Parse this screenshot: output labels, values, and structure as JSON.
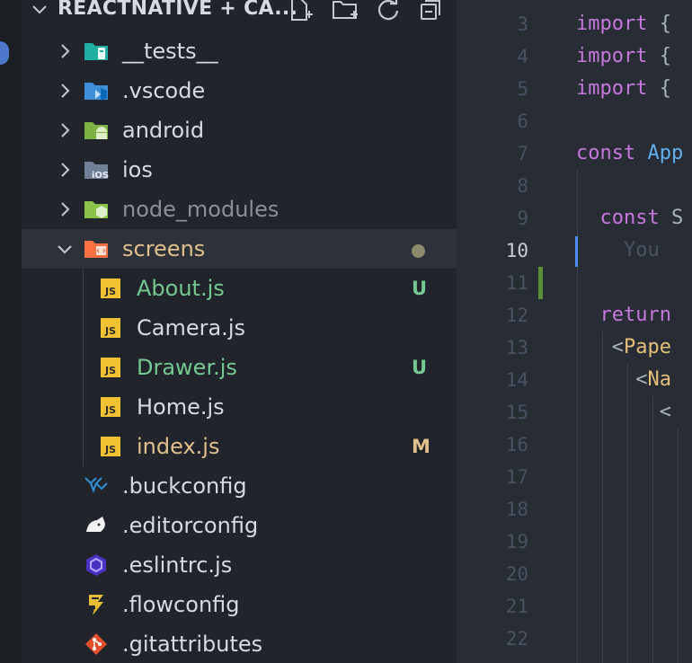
{
  "explorer": {
    "title": "REACTNATIVE + CA...",
    "actions": [
      {
        "name": "new-file-icon"
      },
      {
        "name": "new-folder-icon"
      },
      {
        "name": "refresh-icon"
      },
      {
        "name": "collapse-all-icon"
      }
    ],
    "items": [
      {
        "label": "__tests__",
        "type": "folder",
        "icon": "folder-tests-icon",
        "expanded": false
      },
      {
        "label": ".vscode",
        "type": "folder",
        "icon": "folder-vscode-icon",
        "expanded": false
      },
      {
        "label": "android",
        "type": "folder",
        "icon": "folder-android-icon",
        "expanded": false
      },
      {
        "label": "ios",
        "type": "folder",
        "icon": "folder-ios-icon",
        "expanded": false
      },
      {
        "label": "node_modules",
        "type": "folder",
        "icon": "folder-node-icon",
        "expanded": false,
        "dimmed": true
      },
      {
        "label": "screens",
        "type": "folder",
        "icon": "folder-screens-icon",
        "expanded": true,
        "selected": true,
        "status": "dot",
        "color": "orange"
      },
      {
        "label": "About.js",
        "type": "file",
        "icon": "js-file-icon",
        "indent": 1,
        "badge": "U",
        "color": "green"
      },
      {
        "label": "Camera.js",
        "type": "file",
        "icon": "js-file-icon",
        "indent": 1
      },
      {
        "label": "Drawer.js",
        "type": "file",
        "icon": "js-file-icon",
        "indent": 1,
        "badge": "U",
        "color": "green"
      },
      {
        "label": "Home.js",
        "type": "file",
        "icon": "js-file-icon",
        "indent": 1
      },
      {
        "label": "index.js",
        "type": "file",
        "icon": "js-file-icon",
        "indent": 1,
        "badge": "M",
        "color": "orange"
      },
      {
        "label": ".buckconfig",
        "type": "file",
        "icon": "buck-icon"
      },
      {
        "label": ".editorconfig",
        "type": "file",
        "icon": "editorconfig-icon"
      },
      {
        "label": ".eslintrc.js",
        "type": "file",
        "icon": "eslint-icon"
      },
      {
        "label": ".flowconfig",
        "type": "file",
        "icon": "flow-icon"
      },
      {
        "label": ".gitattributes",
        "type": "file",
        "icon": "git-icon"
      }
    ]
  },
  "editor": {
    "first_line": 3,
    "active_line": 10,
    "lines": [
      {
        "n": "3",
        "tokens": [
          {
            "t": "import",
            "c": "kw"
          },
          {
            "t": " {",
            "c": "p"
          }
        ]
      },
      {
        "n": "4",
        "tokens": [
          {
            "t": "import",
            "c": "kw"
          },
          {
            "t": " {",
            "c": "p"
          }
        ]
      },
      {
        "n": "5",
        "tokens": [
          {
            "t": "import",
            "c": "kw"
          },
          {
            "t": " {",
            "c": "p"
          }
        ]
      },
      {
        "n": "6",
        "tokens": []
      },
      {
        "n": "7",
        "tokens": [
          {
            "t": "const",
            "c": "kw"
          },
          {
            "t": " ",
            "c": "p"
          },
          {
            "t": "App",
            "c": "fn"
          }
        ]
      },
      {
        "n": "8",
        "tokens": []
      },
      {
        "n": "9",
        "tokens": [
          {
            "t": "  ",
            "c": "p"
          },
          {
            "t": "const",
            "c": "kw"
          },
          {
            "t": " S",
            "c": "p"
          }
        ]
      },
      {
        "n": "10",
        "tokens": [
          {
            "t": "    You",
            "c": "ghost"
          }
        ]
      },
      {
        "n": "11",
        "tokens": []
      },
      {
        "n": "12",
        "tokens": [
          {
            "t": "  ",
            "c": "p"
          },
          {
            "t": "return",
            "c": "kw"
          }
        ]
      },
      {
        "n": "13",
        "tokens": [
          {
            "t": "   <",
            "c": "p"
          },
          {
            "t": "Pape",
            "c": "tag"
          }
        ]
      },
      {
        "n": "14",
        "tokens": [
          {
            "t": "     <",
            "c": "p"
          },
          {
            "t": "Na",
            "c": "tag"
          }
        ]
      },
      {
        "n": "15",
        "tokens": [
          {
            "t": "       <",
            "c": "p"
          }
        ]
      },
      {
        "n": "16",
        "tokens": []
      },
      {
        "n": "17",
        "tokens": []
      },
      {
        "n": "18",
        "tokens": []
      },
      {
        "n": "19",
        "tokens": []
      },
      {
        "n": "20",
        "tokens": []
      },
      {
        "n": "21",
        "tokens": []
      },
      {
        "n": "22",
        "tokens": []
      }
    ]
  }
}
